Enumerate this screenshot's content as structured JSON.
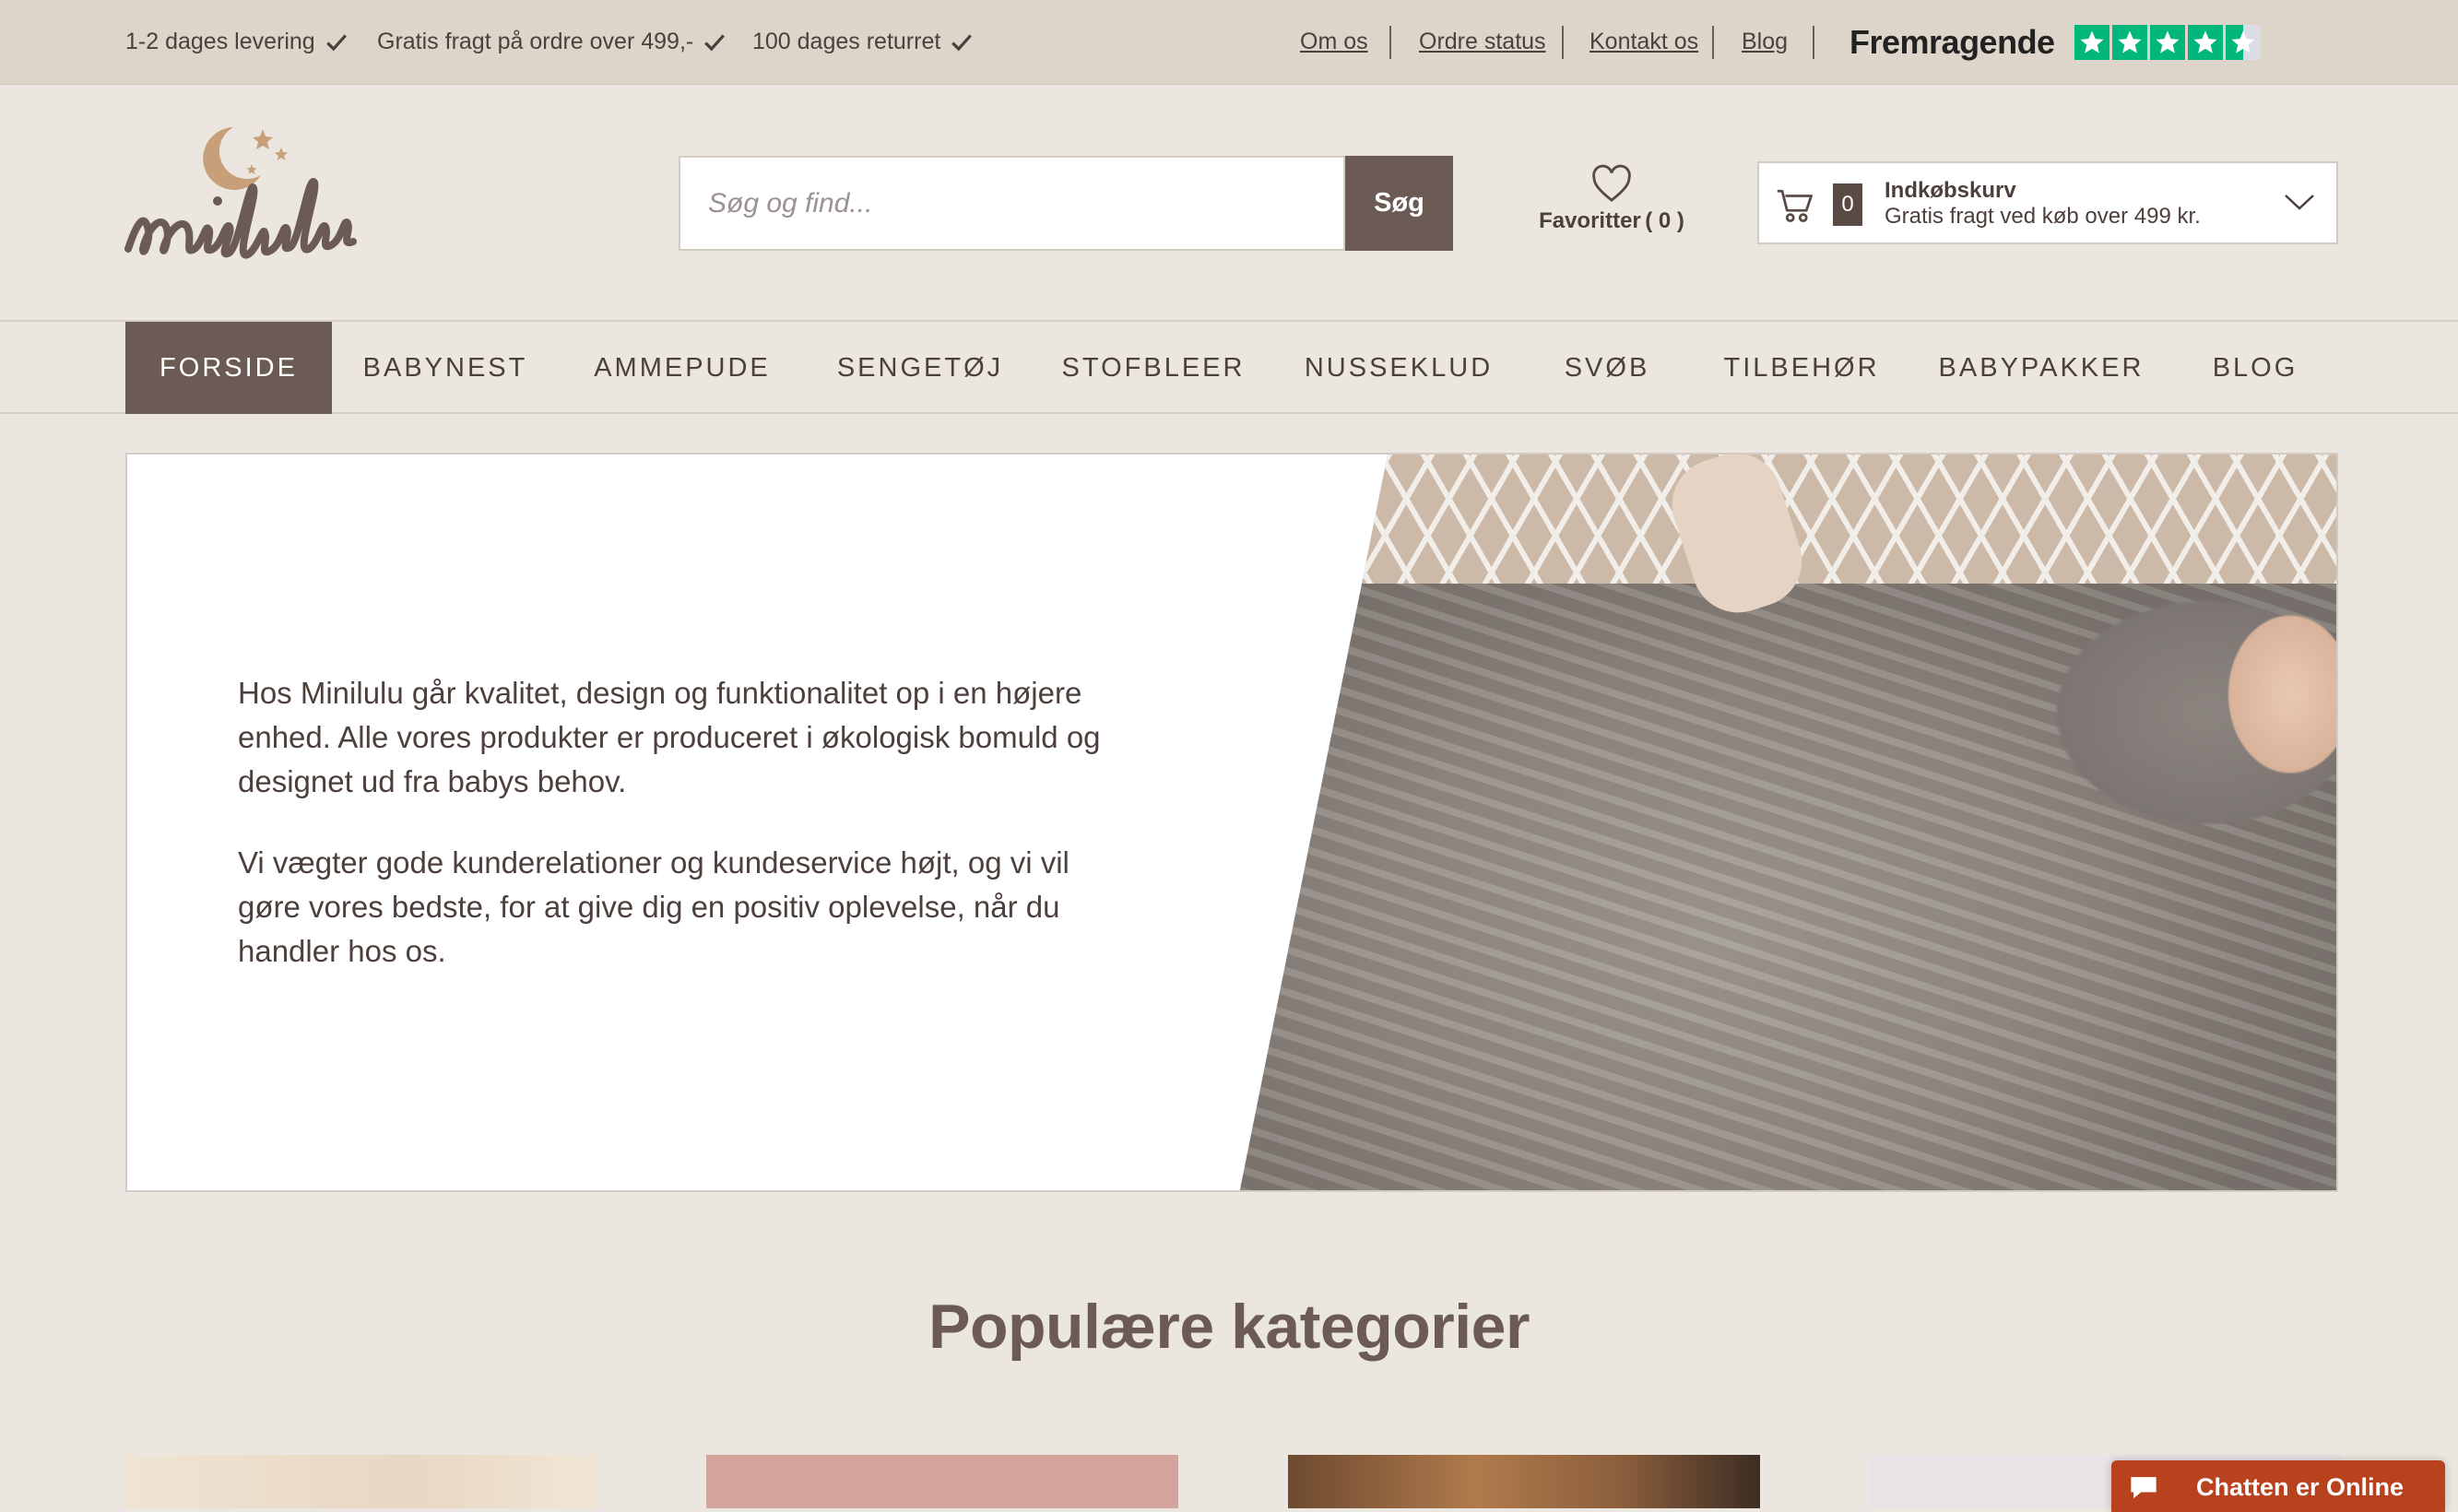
{
  "topbar": {
    "usps": [
      "1-2 dages levering",
      "Gratis fragt på ordre over 499,-",
      "100 dages returret"
    ],
    "links": [
      "Om os",
      "Ordre status",
      "Kontakt os",
      "Blog"
    ],
    "trustpilot": {
      "label": "Fremragende",
      "rating_stars": 4.5,
      "star_color": "#00b67a"
    }
  },
  "header": {
    "logo_text": "minilulu",
    "search": {
      "placeholder": "Søg og find...",
      "value": "",
      "button_label": "Søg"
    },
    "favorites": {
      "label": "Favoritter",
      "count_text": "( 0 )"
    },
    "cart": {
      "count": "0",
      "title": "Indkøbskurv",
      "subtitle": "Gratis fragt ved køb over 499 kr."
    }
  },
  "nav": {
    "items": [
      "FORSIDE",
      "BABYNEST",
      "AMMEPUDE",
      "SENGETØJ",
      "STOFBLEER",
      "NUSSEKLUD",
      "SVØB",
      "TILBEHØR",
      "BABYPAKKER",
      "BLOG"
    ],
    "active": "FORSIDE"
  },
  "hero": {
    "paragraph_1": "Hos Minilulu går kvalitet, design og funktionalitet op i en højere enhed. Alle vores produkter er produceret i økologisk bomuld og designet ud fra babys behov.",
    "paragraph_2": "Vi vægter gode kunderelationer og kundeservice højt, og vi vil gøre vores bedste, for at give dig en positiv oplevelse, når du handler hos os."
  },
  "categories": {
    "title": "Populære kategorier"
  },
  "chat": {
    "label": "Chatten er Online"
  },
  "colors": {
    "brand": "#6c5a55",
    "topbar_bg": "#ddd5c9",
    "page_bg": "#ebe7e0",
    "chat": "#b8421e"
  }
}
